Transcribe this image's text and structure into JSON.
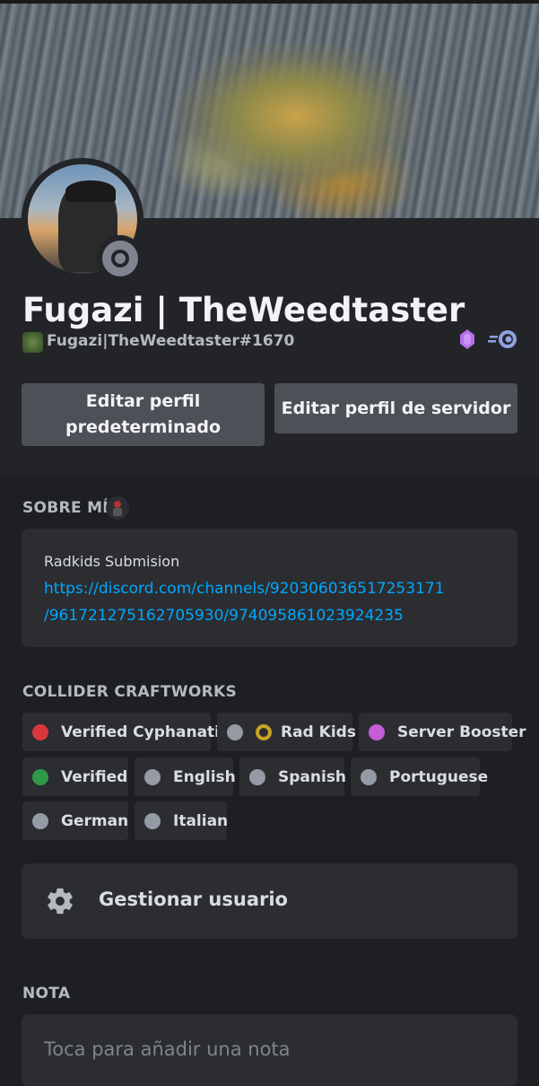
{
  "profile": {
    "display_name": "Fugazi | TheWeedtaster",
    "username": "Fugazi|TheWeedtaster#1670",
    "status": "offline"
  },
  "actions": {
    "edit_default": "Editar perfil predeterminado",
    "edit_server": "Editar perfil de servidor"
  },
  "about": {
    "title": "SOBRE MÍ",
    "text": "Radkids Submision",
    "link_line1": "https://discord.com/channels/920306036517253171",
    "link_line2": "/961721275162705930/974095861023924235"
  },
  "roles": {
    "title": "COLLIDER CRAFTWORKS",
    "items": [
      {
        "label": "Verified Cyphanatic",
        "color": "#da373c"
      },
      {
        "label": "Rad Kids",
        "color": "#949ba4"
      },
      {
        "label": "Server Booster",
        "color": "#c45dd6"
      },
      {
        "label": "Verified",
        "color": "#2f9a4a"
      },
      {
        "label": "English",
        "color": "#949ba4"
      },
      {
        "label": "Spanish",
        "color": "#949ba4"
      },
      {
        "label": "Portuguese",
        "color": "#949ba4"
      },
      {
        "label": "German",
        "color": "#949ba4"
      },
      {
        "label": "Italian",
        "color": "#949ba4"
      }
    ]
  },
  "manage": {
    "label": "Gestionar usuario",
    "icon": "gear-icon"
  },
  "note": {
    "title": "NOTA",
    "placeholder": "Toca para añadir una nota"
  },
  "colors": {
    "background": "#1e1f22",
    "card": "#2b2d31",
    "button": "#4e5058",
    "link": "#00a8fc"
  }
}
